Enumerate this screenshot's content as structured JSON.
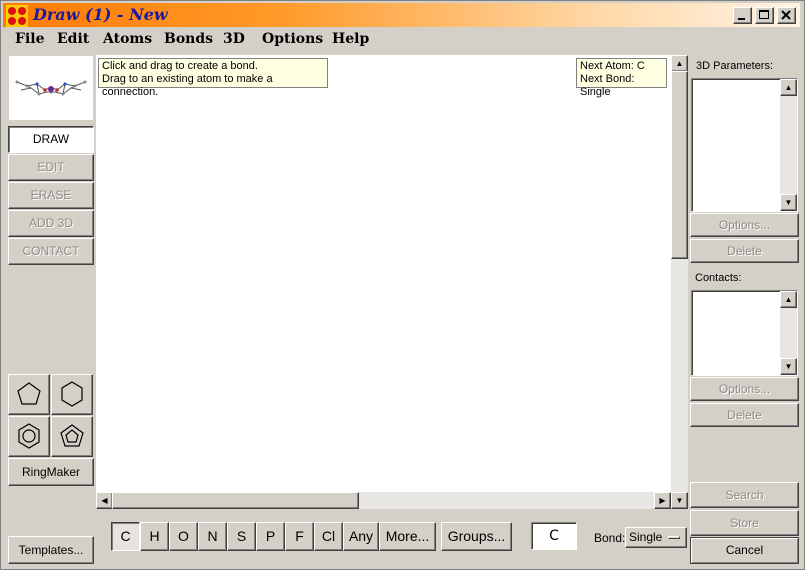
{
  "window": {
    "title": "Draw (1) - New"
  },
  "menu": [
    "File",
    "Edit",
    "Atoms",
    "Bonds",
    "3D",
    "Options",
    "Help"
  ],
  "modes": {
    "draw": "DRAW",
    "edit": "EDIT",
    "erase": "ERASE",
    "add3d": "ADD 3D",
    "contact": "CONTACT"
  },
  "ring_tools": {
    "icons": [
      "pentagon-icon",
      "hexagon-icon",
      "benzene-icon",
      "cyclopentadienyl-icon"
    ],
    "ringmaker_label": "RingMaker"
  },
  "templates_label": "Templates...",
  "canvas": {
    "hint_line1": "Click and drag to create a bond.",
    "hint_line2": "Drag to an existing atom to make a connection.",
    "next_atom": "Next Atom: C",
    "next_bond": "Next Bond: Single"
  },
  "elements": [
    "C",
    "H",
    "O",
    "N",
    "S",
    "P",
    "F",
    "Cl",
    "Any"
  ],
  "more_label": "More...",
  "groups_label": "Groups...",
  "current_atom": "C",
  "bond": {
    "label": "Bond:",
    "value": "Single"
  },
  "right_panel": {
    "params_label": "3D Parameters:",
    "contacts_label": "Contacts:",
    "options_label": "Options...",
    "delete_label": "Delete",
    "search_label": "Search",
    "store_label": "Store",
    "cancel_label": "Cancel"
  },
  "colors": {
    "title_gradient_start": "#ff7a00",
    "title_text": "#1a1aa0",
    "tooltip_bg": "#ffffe1",
    "face": "#d4d0c8"
  }
}
